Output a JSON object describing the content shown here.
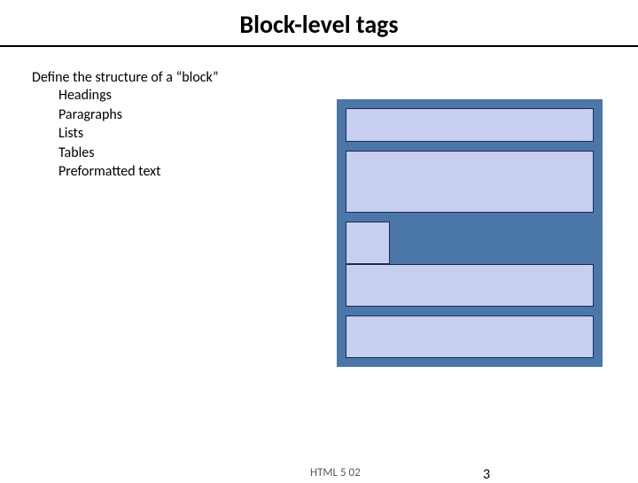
{
  "slide": {
    "title": "Block-level tags",
    "lead": "Define the structure of a “block”",
    "items": [
      "Headings",
      "Paragraphs",
      "Lists",
      "Tables",
      "Preformatted text"
    ]
  },
  "footer": {
    "label": "HTML 5 02",
    "page": "3"
  }
}
